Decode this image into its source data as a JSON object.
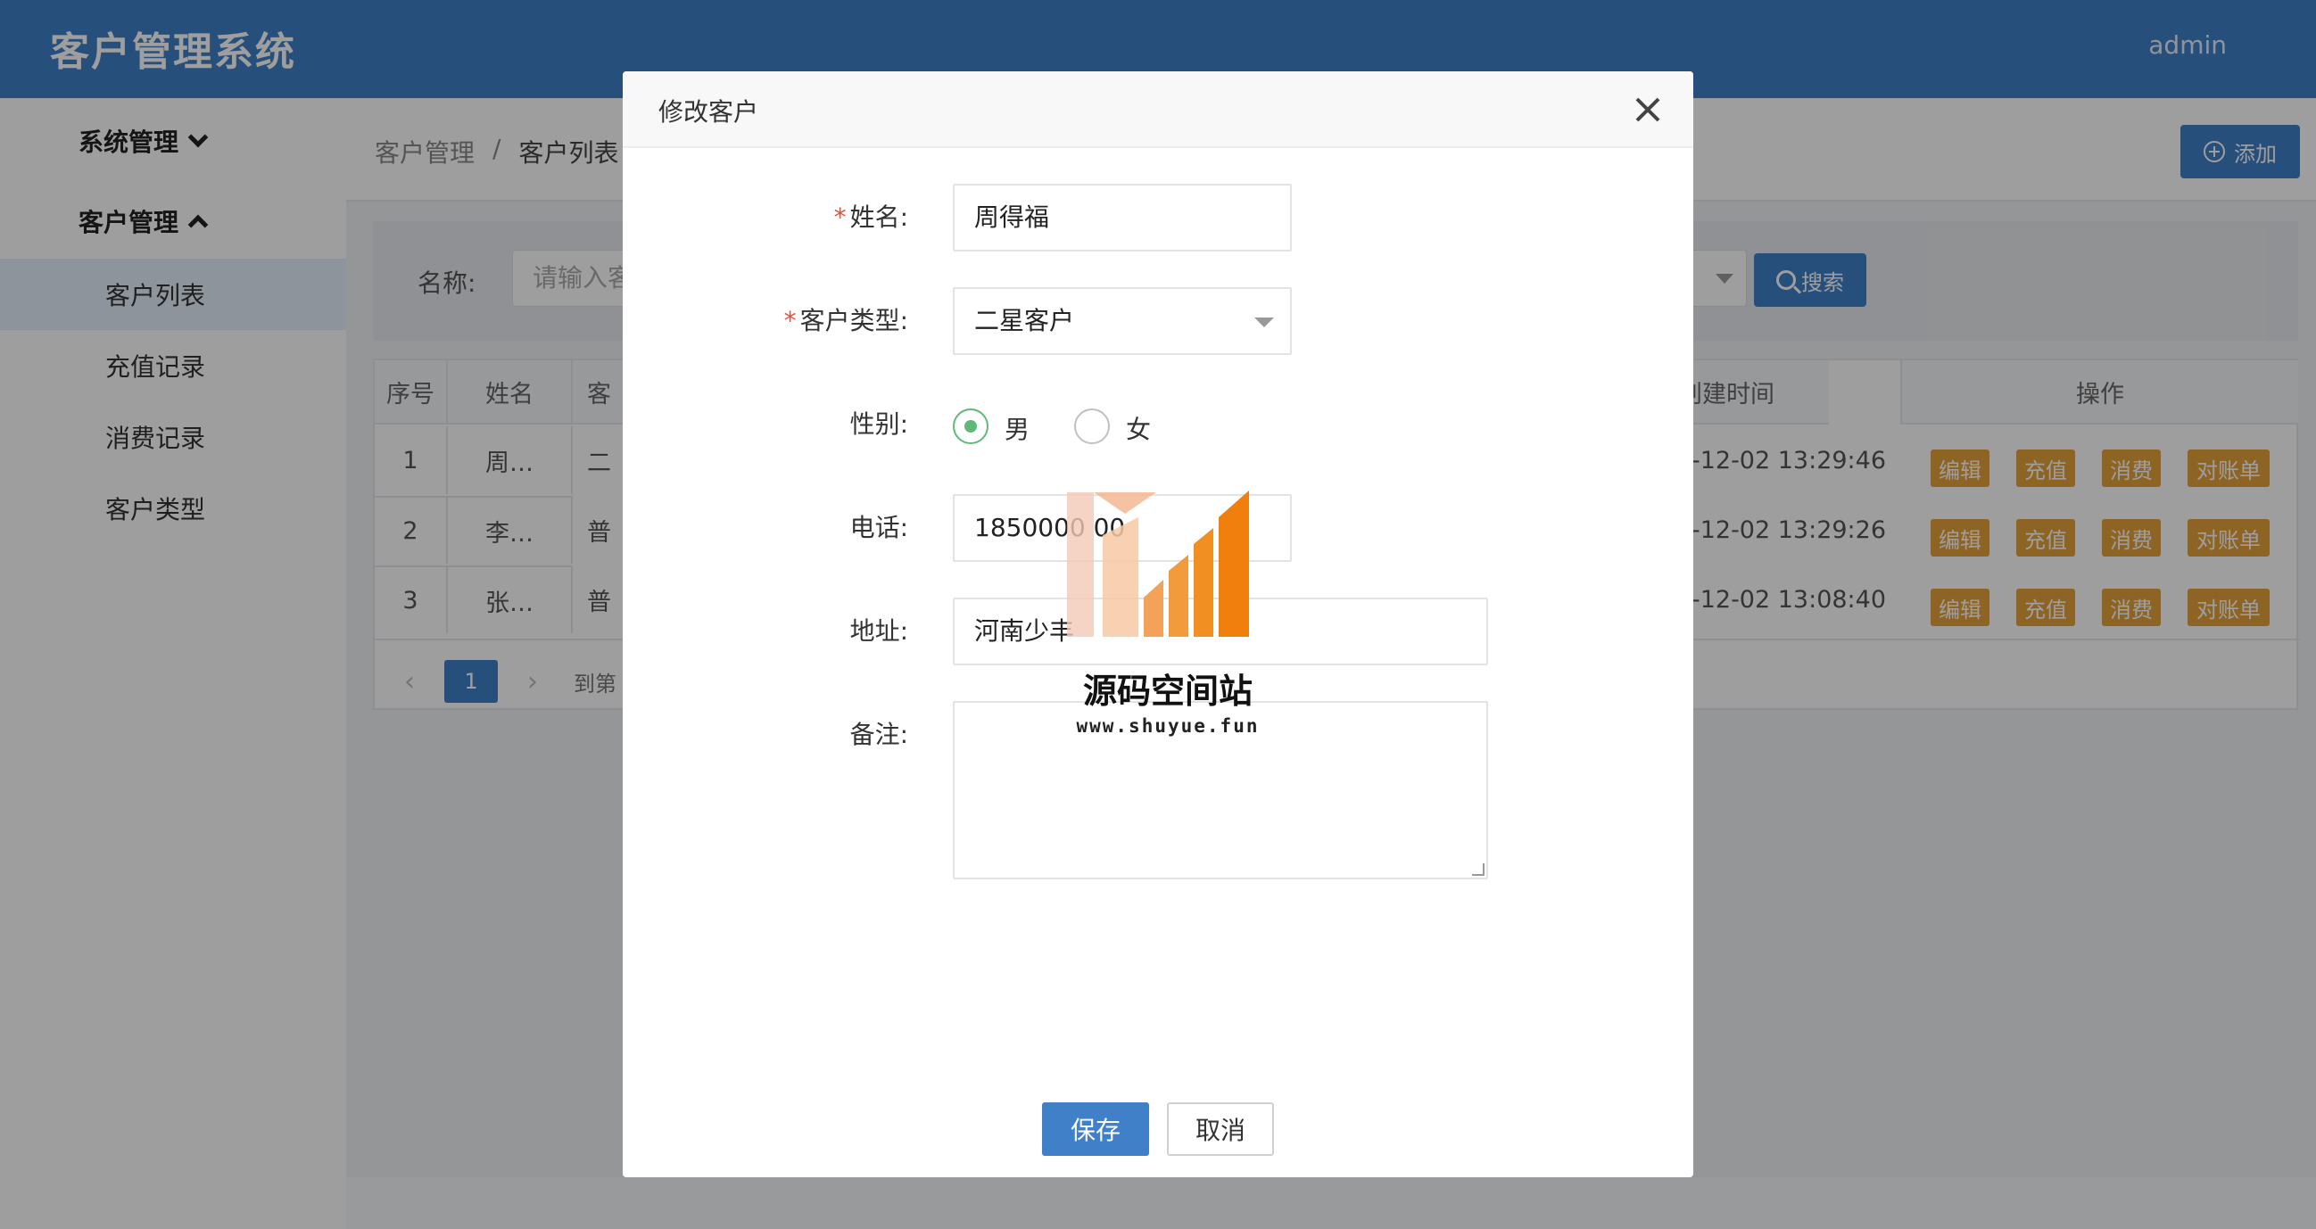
{
  "app": {
    "title": "客户管理系统",
    "user": "admin"
  },
  "sidebar": {
    "groups": [
      {
        "label": "系统管理",
        "expanded": false
      },
      {
        "label": "客户管理",
        "expanded": true
      }
    ],
    "items": [
      {
        "label": "客户列表",
        "active": true
      },
      {
        "label": "充值记录",
        "active": false
      },
      {
        "label": "消费记录",
        "active": false
      },
      {
        "label": "客户类型",
        "active": false
      }
    ]
  },
  "breadcrumb": {
    "parent": "客户管理",
    "separator": "/",
    "current": "客户列表"
  },
  "toolbar": {
    "add_label": "添加"
  },
  "search": {
    "name_label": "名称:",
    "name_placeholder": "请输入客",
    "search_label": "搜索"
  },
  "table": {
    "headers": [
      "序号",
      "姓名",
      "客",
      "创建时间",
      "操作"
    ],
    "rows": [
      {
        "index": "1",
        "name": "周…",
        "type": "二",
        "created": "-12-02 13:29:46"
      },
      {
        "index": "2",
        "name": "李…",
        "type": "普",
        "created": "-12-02 13:29:26"
      },
      {
        "index": "3",
        "name": "张…",
        "type": "普",
        "created": "-12-02 13:08:40"
      }
    ],
    "actions": [
      "编辑",
      "充值",
      "消费",
      "对账单"
    ],
    "pager": {
      "current": "1",
      "goto_label": "到第"
    }
  },
  "dialog": {
    "title": "修改客户",
    "fields": {
      "name": {
        "label": "姓名:",
        "value": "周得福",
        "required": true
      },
      "type": {
        "label": "客户类型:",
        "value": "二星客户",
        "required": true
      },
      "gender": {
        "label": "性别:",
        "options": [
          "男",
          "女"
        ],
        "selected": "男"
      },
      "phone": {
        "label": "电话:",
        "value": "1850000 00"
      },
      "address": {
        "label": "地址:",
        "value": "河南少丰"
      },
      "remark": {
        "label": "备注:",
        "value": ""
      }
    },
    "save_label": "保存",
    "cancel_label": "取消"
  },
  "watermark": {
    "text": "源码空间站",
    "url": "www.shuyue.fun"
  },
  "colors": {
    "header": "#3f80c8",
    "primary": "#3f80c8",
    "warning": "#e6a23c",
    "radio": "#5fb878",
    "required": "#e74c3c"
  }
}
